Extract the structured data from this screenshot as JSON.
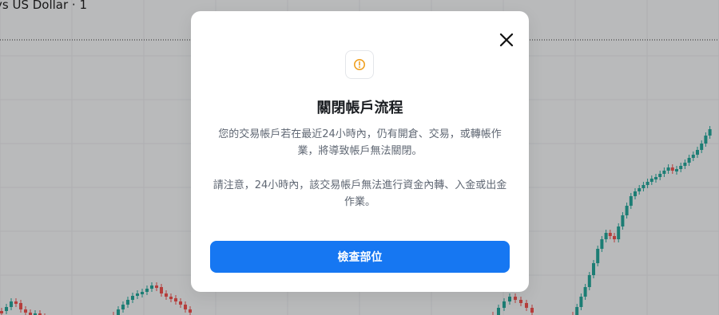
{
  "chart": {
    "title": "ys US Dollar · 1",
    "up_color": "#26a69a",
    "down_color": "#ef5350"
  },
  "modal": {
    "icon": "warning-icon",
    "close_icon": "close-icon",
    "title": "關閉帳戶流程",
    "paragraph_1": "您的交易帳戶若在最近24小時內，仍有開倉、交易，或轉帳作業，將導致帳戶無法關閉。",
    "paragraph_2": "請注意，24小時內，該交易帳戶無法進行資金內轉、入金或出金作業。",
    "primary_button": "檢查部位",
    "accent_color": "#1677f2",
    "warning_color": "#f0a020"
  }
}
